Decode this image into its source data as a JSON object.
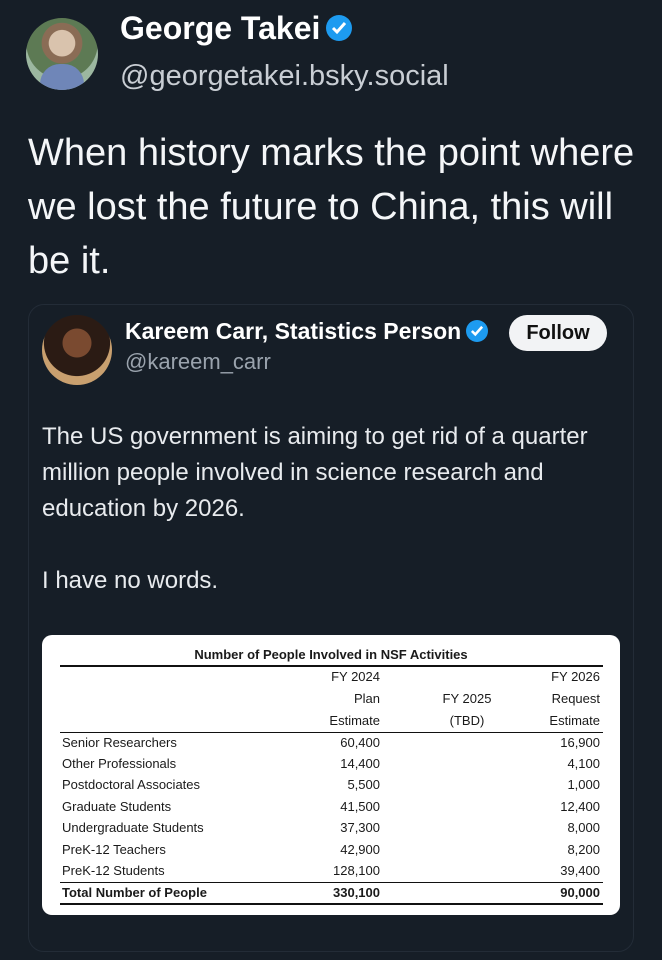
{
  "post": {
    "author_name": "George Takei",
    "handle": "@georgetakei.bsky.social",
    "text": "When history marks the point where we lost the future to China, this will be it."
  },
  "quote": {
    "author_name": "Kareem Carr, Statistics Person",
    "handle": "@kareem_carr",
    "follow_label": "Follow",
    "text_1": "The US government is aiming to get rid of a quarter million people involved in science research and education by 2026.",
    "text_2": "I have no words."
  },
  "table": {
    "title": "Number of People Involved in NSF Activities",
    "col_fy2024": [
      "FY 2024",
      "Plan",
      "Estimate"
    ],
    "col_fy2025": [
      "FY 2025",
      "(TBD)"
    ],
    "col_fy2026": [
      "FY 2026",
      "Request",
      "Estimate"
    ],
    "rows": [
      {
        "label": "Senior Researchers",
        "fy2024": "60,400",
        "fy2026": "16,900"
      },
      {
        "label": "Other Professionals",
        "fy2024": "14,400",
        "fy2026": "4,100"
      },
      {
        "label": "Postdoctoral Associates",
        "fy2024": "5,500",
        "fy2026": "1,000"
      },
      {
        "label": "Graduate Students",
        "fy2024": "41,500",
        "fy2026": "12,400"
      },
      {
        "label": "Undergraduate Students",
        "fy2024": "37,300",
        "fy2026": "8,000"
      },
      {
        "label": "PreK-12 Teachers",
        "fy2024": "42,900",
        "fy2026": "8,200"
      },
      {
        "label": "PreK-12 Students",
        "fy2024": "128,100",
        "fy2026": "39,400"
      }
    ],
    "total": {
      "label": "Total Number of People",
      "fy2024": "330,100",
      "fy2026": "90,000"
    }
  },
  "colors": {
    "background": "#161e27",
    "verified": "#1d9bf0",
    "follow_bg": "#f2f3f5"
  },
  "icons": {
    "verified": "verified-badge-icon"
  }
}
